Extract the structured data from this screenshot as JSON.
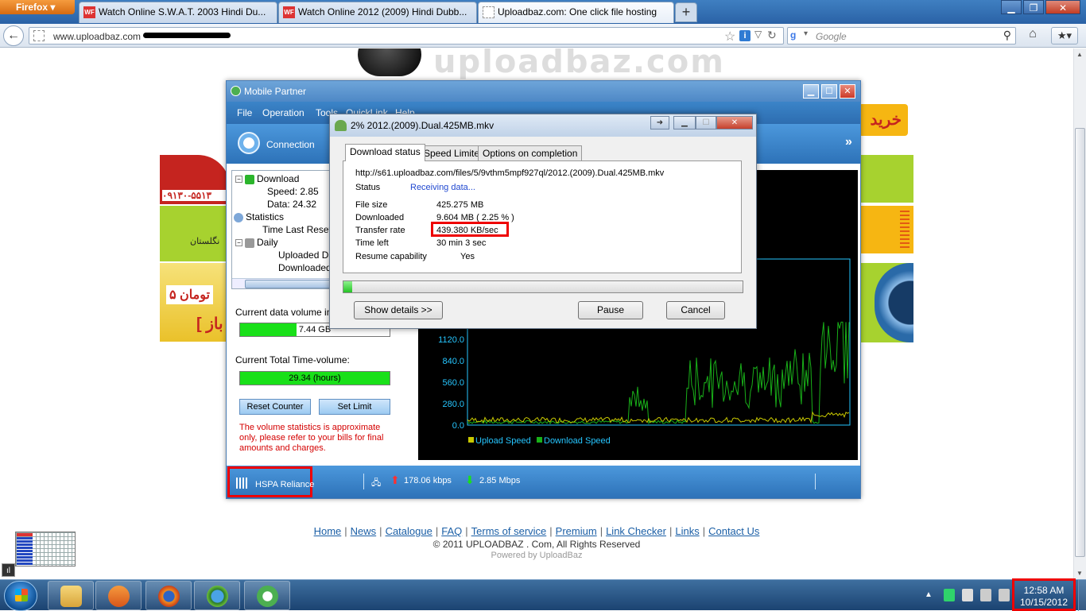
{
  "browser": {
    "menu_button": "Firefox",
    "tabs": [
      {
        "favicon": "WF",
        "title": "Watch Online S.W.A.T. 2003 Hindi Du..."
      },
      {
        "favicon": "WF",
        "title": "Watch Online 2012 (2009) Hindi Dubb..."
      },
      {
        "favicon": "",
        "title": "Uploadbaz.com: One click file hosting"
      }
    ],
    "new_tab": "+",
    "url": "www.uploadbaz.com",
    "search_placeholder": "Google",
    "search_engine_icon": "google-icon"
  },
  "page": {
    "logo_text": "uploadbaz.com",
    "ad_left": {
      "phone": "۰۹۱۳۰-۵۵۱۳",
      "line": "نگلستان",
      "price": "۵ تومان",
      "bracket": "[ باز"
    },
    "ad_right": {
      "word": "خرید"
    },
    "footer_links": [
      "Home",
      "News",
      "Catalogue",
      "FAQ",
      "Terms of service",
      "Premium",
      "Link Checker",
      "Links",
      "Contact Us"
    ],
    "copyright": "© 2011 UPLOADBAZ . Com, All Rights Reserved",
    "powered_by": "Powered by UploadBaz"
  },
  "mobile_partner": {
    "title": "Mobile Partner",
    "menus": [
      "File",
      "Operation",
      "Tools",
      "QuickLink",
      "Help"
    ],
    "connection_label": "Connection",
    "more": "»",
    "tree": {
      "download": "Download",
      "speed": "Speed: 2.85",
      "data": "Data: 24.32",
      "statistics": "Statistics",
      "time_last_reset": "Time Last Reset:",
      "daily": "Daily",
      "uploaded": "Uploaded Dat",
      "downloaded": "Downloaded"
    },
    "current_data_label": "Current data volume in th",
    "current_data_value": "7.44 GB",
    "current_data_fraction": 0.38,
    "current_time_label": "Current Total Time-volume:",
    "current_time_value": "29.34 (hours)",
    "current_time_fraction": 1.0,
    "reset_button": "Reset Counter",
    "limit_button": "Set Limit",
    "note": "The volume statistics is approximate only, please refer to your bills for final amounts and charges.",
    "network": "HSPA  Reliance",
    "upload_speed": "178.06 kbps",
    "download_speed": "2.85 Mbps"
  },
  "chart_data": {
    "type": "line",
    "y_ticks": [
      "1120.0",
      "840.0",
      "560.0",
      "280.0",
      "0.0"
    ],
    "ylim": [
      0,
      1120
    ],
    "series": [
      {
        "name": "Upload Speed",
        "color": "#c8c800"
      },
      {
        "name": "Download Speed",
        "color": "#19b019"
      }
    ]
  },
  "download_dialog": {
    "title": "2% 2012.(2009).Dual.425MB.mkv",
    "tabs": [
      "Download status",
      "Speed Limiter",
      "Options on completion"
    ],
    "url": "http://s61.uploadbaz.com/files/5/9vthm5mpf927ql/2012.(2009).Dual.425MB.mkv",
    "status_label": "Status",
    "status_value": "Receiving data...",
    "file_size_label": "File size",
    "file_size_value": "425.275  MB",
    "downloaded_label": "Downloaded",
    "downloaded_value": "9.604  MB  ( 2.25 % )",
    "rate_label": "Transfer rate",
    "rate_value": "439.380  KB/sec",
    "time_left_label": "Time left",
    "time_left_value": "30 min 3 sec",
    "resume_label": "Resume capability",
    "resume_value": "Yes",
    "progress_fraction": 0.0225,
    "show_details": "Show details >>",
    "pause": "Pause",
    "cancel": "Cancel"
  },
  "taskbar": {
    "time": "12:58 AM",
    "date": "10/15/2012"
  }
}
